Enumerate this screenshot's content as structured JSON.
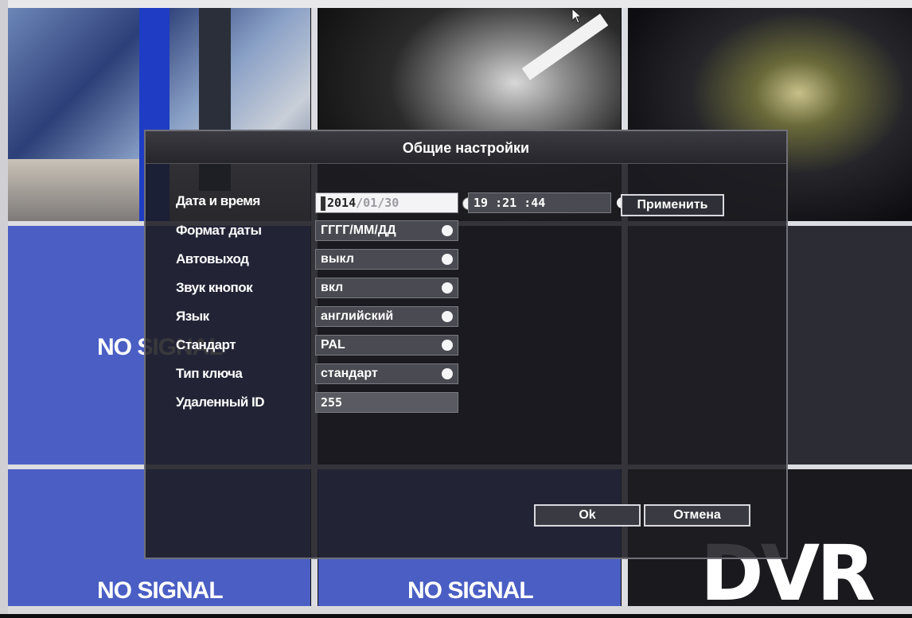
{
  "dialog": {
    "title": "Общие настройки",
    "rows": [
      {
        "label": "Дата и время"
      },
      {
        "label": "Формат даты",
        "value": "ГГГГ/ММ/ДД"
      },
      {
        "label": "Автовыход",
        "value": "выкл"
      },
      {
        "label": "Звук кнопок",
        "value": "вкл"
      },
      {
        "label": "Язык",
        "value": "английский"
      },
      {
        "label": "Стандарт",
        "value": "PAL"
      },
      {
        "label": "Тип ключа",
        "value": "стандарт"
      },
      {
        "label": "Удаленный ID",
        "value": "255"
      }
    ],
    "date": {
      "year": "2014",
      "rest": "/01/30"
    },
    "time": "19 :21 :44",
    "apply_label": "Применить",
    "ok_label": "Ok",
    "cancel_label": "Отмена"
  },
  "background": {
    "no_signal_left": "NO SIGNAL",
    "no_signal_bottom_left": "NO SIGNAL",
    "no_signal_bottom_mid": "NO SIGNAL",
    "logo_text": "DVR"
  }
}
